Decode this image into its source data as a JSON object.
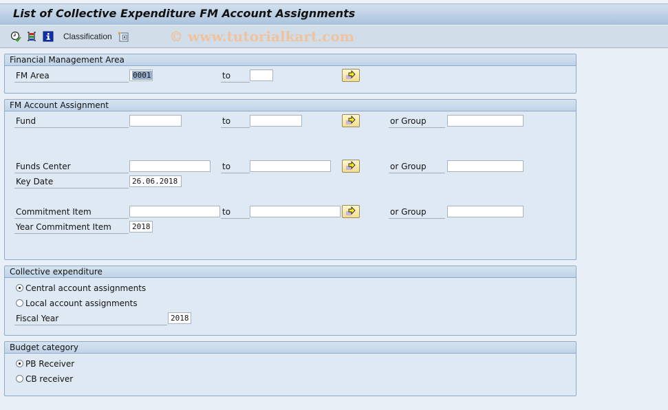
{
  "window": {
    "title": "List of Collective Expenditure FM Account Assignments"
  },
  "toolbar": {
    "execute_icon": "execute-clock-check-icon",
    "selection_options_icon": "selection-options-icon",
    "info_icon": "information-icon",
    "classification_label": "Classification",
    "expand_icon": "expand-dynamic-selections-icon",
    "watermark": "© www.tutorialkart.com"
  },
  "groups": {
    "fm_area": {
      "title": "Financial Management Area",
      "fm_area_label": "FM Area",
      "fm_area_value": "0001",
      "to_label": "to",
      "to_value": ""
    },
    "account_assignment": {
      "title": "FM Account Assignment",
      "fund_label": "Fund",
      "fund_value": "",
      "fund_to_label": "to",
      "fund_to_value": "",
      "fund_group_label": "or Group",
      "fund_group_value": "",
      "funds_center_label": "Funds Center",
      "funds_center_value": "",
      "funds_center_to_label": "to",
      "funds_center_to_value": "",
      "funds_center_group_label": "or Group",
      "funds_center_group_value": "",
      "key_date_label": "Key Date",
      "key_date_value": "26.06.2018",
      "commitment_item_label": "Commitment Item",
      "commitment_item_value": "",
      "commitment_item_to_label": "to",
      "commitment_item_to_value": "",
      "commitment_item_group_label": "or Group",
      "commitment_item_group_value": "",
      "year_commitment_item_label": "Year Commitment Item",
      "year_commitment_item_value": "2018"
    },
    "collective_expenditure": {
      "title": "Collective expenditure",
      "options": [
        {
          "label": "Central account assignments",
          "selected": true
        },
        {
          "label": "Local account assignments",
          "selected": false
        }
      ],
      "fiscal_year_label": "Fiscal Year",
      "fiscal_year_value": "2018"
    },
    "budget_category": {
      "title": "Budget category",
      "options": [
        {
          "label": "PB Receiver",
          "selected": true
        },
        {
          "label": "CB receiver",
          "selected": false
        }
      ]
    }
  },
  "colors": {
    "accent_button": "#f3dd8e",
    "background": "#e8eff7",
    "group_header": "#bfd3e8"
  }
}
